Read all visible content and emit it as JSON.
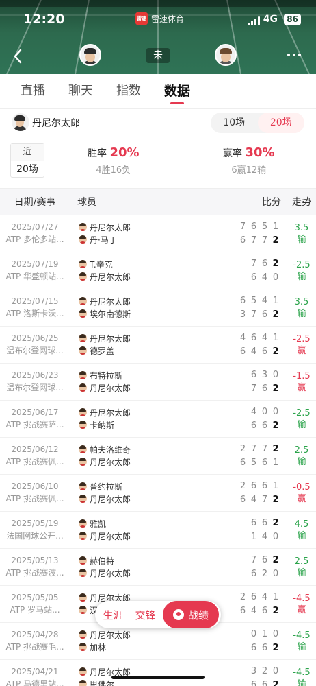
{
  "status_bar": {
    "time": "12:20",
    "network": "4G",
    "battery": "86"
  },
  "brand": {
    "logo_text": "雷速",
    "name": "雷速体育"
  },
  "match": {
    "status": "未"
  },
  "tabs": [
    "直播",
    "聊天",
    "指数",
    "数据"
  ],
  "active_tab": "数据",
  "player": {
    "name": "丹尼尔太郎"
  },
  "range_toggle": {
    "options": [
      "10场",
      "20场"
    ],
    "selected": "20场"
  },
  "summary": {
    "recent_label": "近",
    "recent_count": "20场",
    "win_rate_label": "胜率",
    "win_rate": "20%",
    "win_record": "4胜16负",
    "cover_rate_label": "赢率",
    "cover_rate": "30%",
    "cover_record": "6赢12输"
  },
  "table": {
    "headers": {
      "date_event": "日期/赛事",
      "players": "球员",
      "score": "比分",
      "trend": "走势"
    },
    "rows": [
      {
        "date": "2025/07/27",
        "event": "ATP 多伦多站...",
        "p1": "丹尼尔太郎",
        "p2": "丹·马丁",
        "s1": [
          "7",
          "6",
          "5",
          "1"
        ],
        "s2": [
          "6",
          "7",
          "7",
          "2"
        ],
        "line": "3.5",
        "result": "输",
        "color": "green",
        "win": 2
      },
      {
        "date": "2025/07/19",
        "event": "ATP 华盛顿站...",
        "p1": "T.辛克",
        "p2": "丹尼尔太郎",
        "s1": [
          "7",
          "6",
          "2"
        ],
        "s2": [
          "6",
          "4",
          "0"
        ],
        "line": "-2.5",
        "result": "输",
        "color": "green",
        "win": 1
      },
      {
        "date": "2025/07/15",
        "event": "ATP 洛斯卡沃...",
        "p1": "丹尼尔太郎",
        "p2": "埃尔南德斯",
        "s1": [
          "6",
          "5",
          "4",
          "1"
        ],
        "s2": [
          "3",
          "7",
          "6",
          "2"
        ],
        "line": "3.5",
        "result": "输",
        "color": "green",
        "win": 2
      },
      {
        "date": "2025/06/25",
        "event": "温布尔登网球...",
        "p1": "丹尼尔太郎",
        "p2": "德罗盖",
        "s1": [
          "4",
          "6",
          "4",
          "1"
        ],
        "s2": [
          "6",
          "4",
          "6",
          "2"
        ],
        "line": "-2.5",
        "result": "赢",
        "color": "red",
        "win": 2
      },
      {
        "date": "2025/06/23",
        "event": "温布尔登网球...",
        "p1": "布特拉斯",
        "p2": "丹尼尔太郎",
        "s1": [
          "6",
          "3",
          "0"
        ],
        "s2": [
          "7",
          "6",
          "2"
        ],
        "line": "-1.5",
        "result": "赢",
        "color": "red",
        "win": 2
      },
      {
        "date": "2025/06/17",
        "event": "ATP 挑战赛萨...",
        "p1": "丹尼尔太郎",
        "p2": "卡纳斯",
        "s1": [
          "4",
          "0",
          "0"
        ],
        "s2": [
          "6",
          "6",
          "2"
        ],
        "line": "-2.5",
        "result": "输",
        "color": "green",
        "win": 2
      },
      {
        "date": "2025/06/12",
        "event": "ATP 挑战赛佩...",
        "p1": "帕夫洛维奇",
        "p2": "丹尼尔太郎",
        "s1": [
          "2",
          "7",
          "7",
          "2"
        ],
        "s2": [
          "6",
          "5",
          "6",
          "1"
        ],
        "line": "2.5",
        "result": "输",
        "color": "green",
        "win": 1
      },
      {
        "date": "2025/06/10",
        "event": "ATP 挑战赛佩...",
        "p1": "普约拉斯",
        "p2": "丹尼尔太郎",
        "s1": [
          "2",
          "6",
          "6",
          "1"
        ],
        "s2": [
          "6",
          "4",
          "7",
          "2"
        ],
        "line": "-0.5",
        "result": "赢",
        "color": "red",
        "win": 2
      },
      {
        "date": "2025/05/19",
        "event": "法国网球公开...",
        "p1": "雅凯",
        "p2": "丹尼尔太郎",
        "s1": [
          "6",
          "6",
          "2"
        ],
        "s2": [
          "1",
          "4",
          "0"
        ],
        "line": "4.5",
        "result": "输",
        "color": "green",
        "win": 1
      },
      {
        "date": "2025/05/13",
        "event": "ATP 挑战赛波...",
        "p1": "赫伯特",
        "p2": "丹尼尔太郎",
        "s1": [
          "7",
          "6",
          "2"
        ],
        "s2": [
          "6",
          "2",
          "0"
        ],
        "line": "2.5",
        "result": "输",
        "color": "green",
        "win": 1
      },
      {
        "date": "2025/05/05",
        "event": "ATP 罗马站...",
        "p1": "丹尼尔太郎",
        "p2": "汉",
        "s1": [
          "2",
          "6",
          "4",
          "1"
        ],
        "s2": [
          "6",
          "4",
          "6",
          "2"
        ],
        "line": "-4.5",
        "result": "赢",
        "color": "red",
        "win": 2
      },
      {
        "date": "2025/04/28",
        "event": "ATP 挑战赛毛...",
        "p1": "丹尼尔太郎",
        "p2": "加林",
        "s1": [
          "0",
          "1",
          "0"
        ],
        "s2": [
          "6",
          "6",
          "2"
        ],
        "line": "-4.5",
        "result": "输",
        "color": "green",
        "win": 2
      },
      {
        "date": "2025/04/21",
        "event": "ATP 马德里站...",
        "p1": "丹尼尔太郎",
        "p2": "思佛尔",
        "s1": [
          "3",
          "2",
          "0"
        ],
        "s2": [
          "6",
          "6",
          "2"
        ],
        "line": "-4.5",
        "result": "输",
        "color": "green",
        "win": 2
      }
    ]
  },
  "floating_bar": {
    "career": "生涯",
    "h2h": "交锋",
    "record": "战绩"
  },
  "icons": {
    "back": "back-arrow-icon",
    "more": "more-dots-icon",
    "record": "medal-icon"
  },
  "colors": {
    "accent": "#e53950",
    "win_green": "#2aa34a"
  }
}
